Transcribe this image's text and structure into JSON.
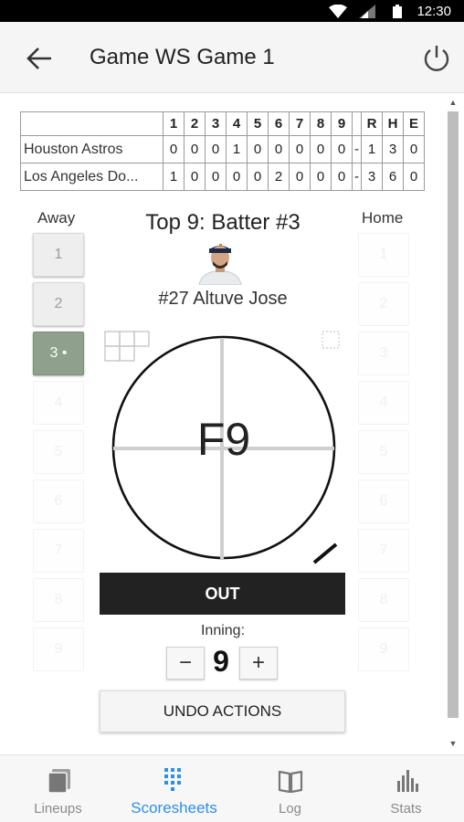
{
  "status_bar": {
    "time": "12:30"
  },
  "app_bar": {
    "title": "Game WS Game 1"
  },
  "scoreboard": {
    "innings": [
      "1",
      "2",
      "3",
      "4",
      "5",
      "6",
      "7",
      "8",
      "9"
    ],
    "totals_headers": [
      "R",
      "H",
      "E"
    ],
    "rows": [
      {
        "team": "Houston Astros",
        "innings": [
          "0",
          "0",
          "0",
          "1",
          "0",
          "0",
          "0",
          "0",
          "0"
        ],
        "sep": "-",
        "totals": [
          "1",
          "3",
          "0"
        ]
      },
      {
        "team": "Los Angeles Do...",
        "innings": [
          "1",
          "0",
          "0",
          "0",
          "0",
          "2",
          "0",
          "0",
          "0"
        ],
        "sep": "-",
        "totals": [
          "3",
          "6",
          "0"
        ]
      }
    ]
  },
  "away": {
    "label": "Away",
    "buttons": [
      "1",
      "2",
      "3 •",
      "4",
      "5",
      "6",
      "7",
      "8",
      "9"
    ]
  },
  "home": {
    "label": "Home",
    "buttons": [
      "1",
      "2",
      "3",
      "4",
      "5",
      "6",
      "7",
      "8",
      "9"
    ]
  },
  "batter": {
    "title": "Top 9: Batter #3",
    "name": "#27 Altuve Jose"
  },
  "play": {
    "result": "F9",
    "action": "OUT"
  },
  "inning": {
    "label": "Inning:",
    "value": "9",
    "minus": "−",
    "plus": "+"
  },
  "undo_label": "UNDO ACTIONS",
  "bottom_nav": [
    {
      "label": "Lineups",
      "icon": "lineups-icon"
    },
    {
      "label": "Scoresheets",
      "icon": "scoresheets-icon"
    },
    {
      "label": "Log",
      "icon": "log-icon"
    },
    {
      "label": "Stats",
      "icon": "stats-icon"
    }
  ],
  "colors": {
    "accent": "#2d8fe8",
    "current_batter": "#8fa08c",
    "out_button": "#222222"
  }
}
